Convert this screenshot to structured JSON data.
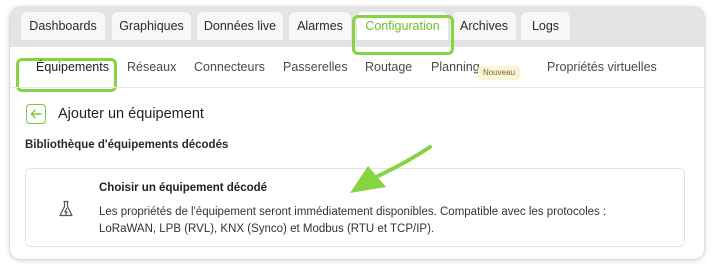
{
  "tabs": [
    {
      "label": "Dashboards",
      "active": false
    },
    {
      "label": "Graphiques",
      "active": false
    },
    {
      "label": "Données live",
      "active": false
    },
    {
      "label": "Alarmes",
      "active": false
    },
    {
      "label": "Configuration",
      "active": true
    },
    {
      "label": "Archives",
      "active": false
    },
    {
      "label": "Logs",
      "active": false
    }
  ],
  "subnav": {
    "items": [
      {
        "label": "Équipements",
        "active": true
      },
      {
        "label": "Réseaux",
        "active": false
      },
      {
        "label": "Connecteurs",
        "active": false
      },
      {
        "label": "Passerelles",
        "active": false
      },
      {
        "label": "Routage",
        "active": false
      },
      {
        "label": "Planning",
        "active": false,
        "badge": "Nouveau"
      },
      {
        "label": "Propriétés virtuelles",
        "active": false
      }
    ]
  },
  "page": {
    "back_icon": "arrow-left-icon",
    "title": "Ajouter un équipement",
    "section_title": "Bibliothèque d'équipements décodés"
  },
  "option": {
    "icon": "flask-lightning-icon",
    "title": "Choisir un équipement décodé",
    "description": "Les propriétés de l'équipement seront immédiatement disponibles. Compatible avec les protocoles : LoRaWAN, LPB (RVL), KNX (Synco) et Modbus (RTU et TCP/IP)."
  },
  "colors": {
    "accent_green": "#86d43f",
    "active_tab_text": "#6cbf2c",
    "tab_bar": "#e4e4e4",
    "badge_bg": "#fbf4d6"
  }
}
